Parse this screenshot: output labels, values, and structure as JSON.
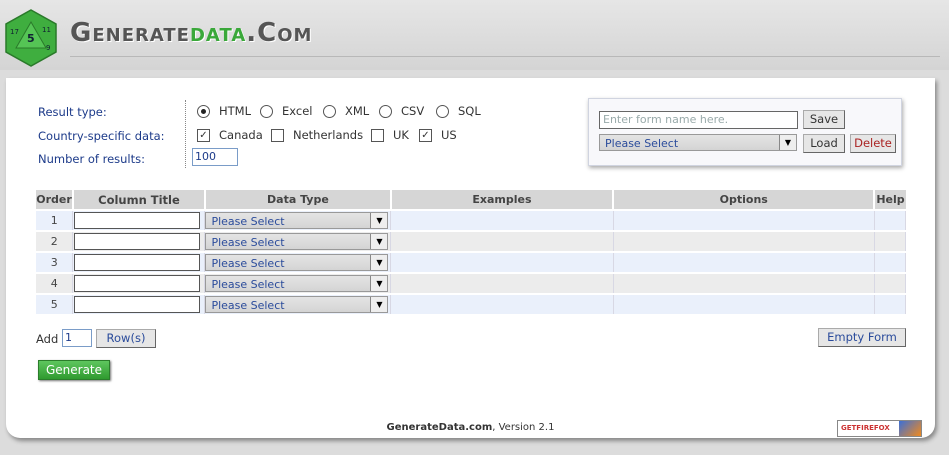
{
  "header": {
    "logo_part1": "Generate",
    "logo_part2": "data",
    "logo_part3": ".Com"
  },
  "settings": {
    "result_type_label": "Result type:",
    "result_types": [
      {
        "label": "HTML",
        "selected": true
      },
      {
        "label": "Excel",
        "selected": false
      },
      {
        "label": "XML",
        "selected": false
      },
      {
        "label": "CSV",
        "selected": false
      },
      {
        "label": "SQL",
        "selected": false
      }
    ],
    "country_label": "Country-specific data:",
    "countries": [
      {
        "label": "Canada",
        "checked": true
      },
      {
        "label": "Netherlands",
        "checked": false
      },
      {
        "label": "UK",
        "checked": false
      },
      {
        "label": "US",
        "checked": true
      }
    ],
    "num_results_label": "Number of results:",
    "num_results": "100"
  },
  "form_manager": {
    "name_placeholder": "Enter form name here.",
    "save_label": "Save",
    "select_value": "Please Select",
    "load_label": "Load",
    "delete_label": "Delete"
  },
  "table": {
    "headers": {
      "order": "Order",
      "column_title": "Column Title",
      "data_type": "Data Type",
      "examples": "Examples",
      "options": "Options",
      "help": "Help"
    },
    "rows": [
      {
        "order": "1",
        "data_type": "Please Select"
      },
      {
        "order": "2",
        "data_type": "Please Select"
      },
      {
        "order": "3",
        "data_type": "Please Select"
      },
      {
        "order": "4",
        "data_type": "Please Select"
      },
      {
        "order": "5",
        "data_type": "Please Select"
      }
    ]
  },
  "controls": {
    "add_label": "Add",
    "add_count": "1",
    "rows_button": "Row(s)",
    "empty_form": "Empty Form",
    "generate": "Generate"
  },
  "footer": {
    "site": "GenerateData.com",
    "version": ", Version 2.1",
    "badge": "GETFIREFOX"
  },
  "colors": {
    "accent_green": "#3aa83a",
    "label_blue": "#1d3b8a"
  }
}
